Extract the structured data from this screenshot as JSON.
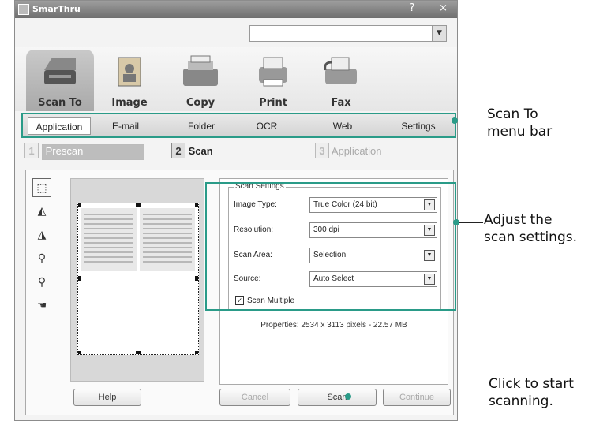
{
  "window": {
    "title": "SmarThru",
    "controls": "? _ ×"
  },
  "top_combo": {
    "value": ""
  },
  "icons": [
    {
      "name": "scan-to",
      "label": "Scan To",
      "active": true
    },
    {
      "name": "image",
      "label": "Image",
      "active": false
    },
    {
      "name": "copy",
      "label": "Copy",
      "active": false
    },
    {
      "name": "print",
      "label": "Print",
      "active": false
    },
    {
      "name": "fax",
      "label": "Fax",
      "active": false
    }
  ],
  "tabs": [
    "Application",
    "E-mail",
    "Folder",
    "OCR",
    "Web",
    "Settings"
  ],
  "steps": [
    {
      "num": "1",
      "label": "Prescan"
    },
    {
      "num": "2",
      "label": "Scan"
    },
    {
      "num": "3",
      "label": "Application"
    }
  ],
  "scan_settings": {
    "legend": "Scan Settings",
    "image_type_label": "Image Type:",
    "image_type_value": "True Color (24 bit)",
    "resolution_label": "Resolution:",
    "resolution_value": "300 dpi",
    "scan_area_label": "Scan Area:",
    "scan_area_value": "Selection",
    "source_label": "Source:",
    "source_value": "Auto Select",
    "scan_multiple_label": "Scan Multiple",
    "scan_multiple_checked": true
  },
  "properties": "Properties: 2534 x 3113 pixels - 22.57 MB",
  "buttons": {
    "help": "Help",
    "cancel": "Cancel",
    "scan": "Scan",
    "continue": "Continue"
  },
  "callouts": {
    "menu_bar": [
      "Scan To",
      "menu bar"
    ],
    "settings": [
      "Adjust the",
      "scan settings."
    ],
    "start": [
      "Click to start",
      "scanning."
    ]
  },
  "colors": {
    "accent": "#2a9b88"
  }
}
